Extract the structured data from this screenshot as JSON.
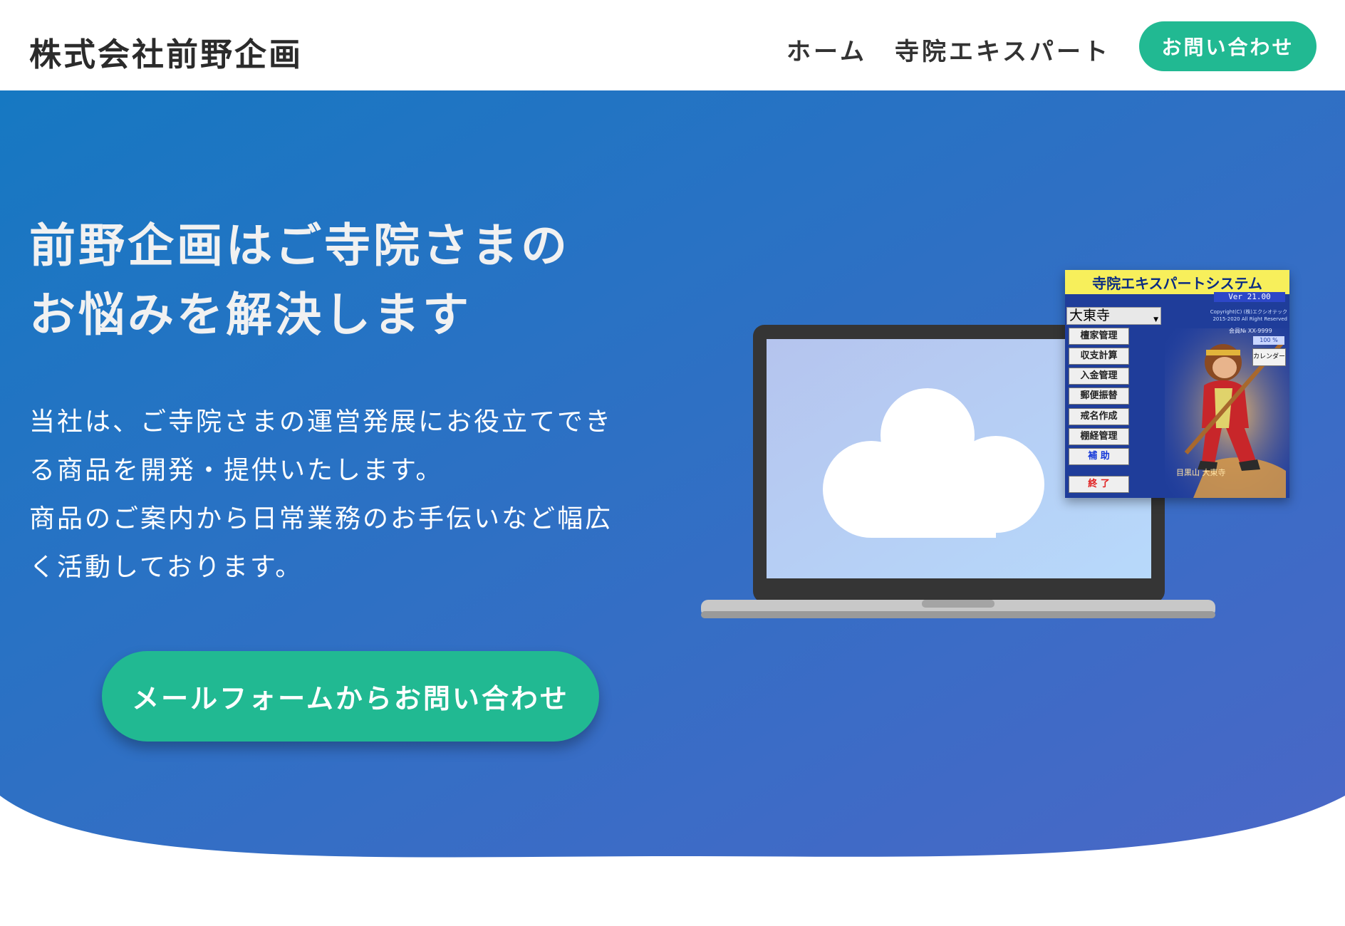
{
  "header": {
    "logo": "株式会社前野企画",
    "nav": [
      {
        "label": "ホーム"
      },
      {
        "label": "寺院エキスパート"
      }
    ],
    "contact_button": "お問い合わせ"
  },
  "hero": {
    "headline_line1": "前野企画はご寺院さまの",
    "headline_line2": "お悩みを解決します",
    "body_lines": [
      "当社は、ご寺院さまの運営発展にお役立てでき",
      "る商品を開発・提供いたします。",
      "商品のご案内から日常業務のお手伝いなど幅広",
      "く活動しております。"
    ],
    "cta_button": "メールフォームからお問い合わせ",
    "colors": {
      "gradient_start": "#1678c2",
      "gradient_end": "#4a67c7",
      "accent": "#21b992"
    }
  },
  "illustration": {
    "laptop_icon": "cloud-icon",
    "app": {
      "title": "寺院エキスパートシステム",
      "version": "Ver 21.00",
      "temple_select": "大東寺",
      "copyright_line1": "Copyright(C) (株)エクシオテック",
      "copyright_line2": "2015-2020 All Right Reserved",
      "member": "会員№ XX-9999",
      "percent": "100 %",
      "calendar_button": "カレンダー",
      "menu": [
        {
          "label": "檀家管理"
        },
        {
          "label": "収支計算"
        },
        {
          "label": "入金管理"
        },
        {
          "label": "郵便振替"
        },
        {
          "label": "戒名作成"
        },
        {
          "label": "棚経管理"
        },
        {
          "label": "補 助"
        },
        {
          "label": "終 了"
        }
      ],
      "temple_caption": "目黒山 大東寺"
    }
  }
}
